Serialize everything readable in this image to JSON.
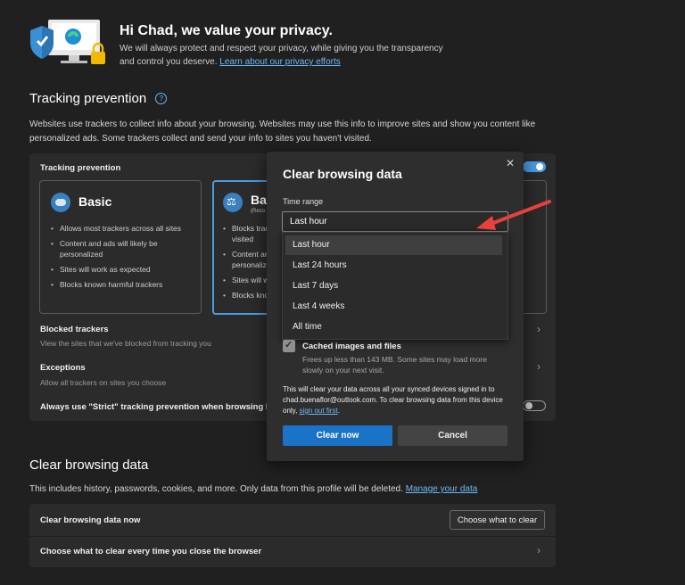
{
  "header": {
    "title": "Hi Chad, we value your privacy.",
    "line1": "We will always protect and respect your privacy, while giving you the transparency",
    "line2_prefix": "and control you deserve.",
    "link": "Learn about our privacy efforts"
  },
  "tracking": {
    "title": "Tracking prevention",
    "desc_line1": "Websites use trackers to collect info about your browsing. Websites may use this info to improve sites and show you content like",
    "desc_line2": "personalized ads. Some trackers collect and send your info to sites you haven't visited.",
    "card_label": "Tracking prevention",
    "basic": {
      "label": "Basic",
      "bullets": [
        "Allows most trackers across all sites",
        "Content and ads will likely be personalized",
        "Sites will work as expected",
        "Blocks known harmful trackers"
      ]
    },
    "balanced": {
      "label": "Bal",
      "sub": "(Reco",
      "bullets": [
        "Blocks trac visited",
        "Content an personaliz",
        "Sites will w",
        "Blocks kno"
      ]
    },
    "blocked_title": "Blocked trackers",
    "blocked_sub": "View the sites that we've blocked from tracking you",
    "exceptions_title": "Exceptions",
    "exceptions_sub": "Allow all trackers on sites you choose",
    "strict_label": "Always use \"Strict\" tracking prevention when browsing I"
  },
  "clear": {
    "title": "Clear browsing data",
    "desc": "This includes history, passwords, cookies, and more. Only data from this profile will be deleted.",
    "desc_link": "Manage your data",
    "now_label": "Clear browsing data now",
    "choose_button": "Choose what to clear",
    "on_close_label": "Choose what to clear every time you close the browser"
  },
  "dialog": {
    "title": "Clear browsing data",
    "close_glyph": "✕",
    "time_range_label": "Time range",
    "selected": "Last hour",
    "options": [
      "Last hour",
      "Last 24 hours",
      "Last 7 days",
      "Last 4 weeks",
      "All time"
    ],
    "cached_title": "Cached images and files",
    "cached_sub": "Frees up less than 143 MB. Some sites may load more slowly on your next visit.",
    "sync_text_1": "This will clear your data across all your synced devices signed in to",
    "sync_email": "chad.buenaflor@outlook.com",
    "sync_text_2": ". To clear browsing data from this",
    "sync_text_3": "device only,",
    "sync_link": "sign out first",
    "clear_now": "Clear now",
    "cancel": "Cancel"
  },
  "colors": {
    "background": "#202020",
    "accent": "#4c9ae2",
    "primary_button": "#1a73c7",
    "arrow": "#e8403c"
  }
}
